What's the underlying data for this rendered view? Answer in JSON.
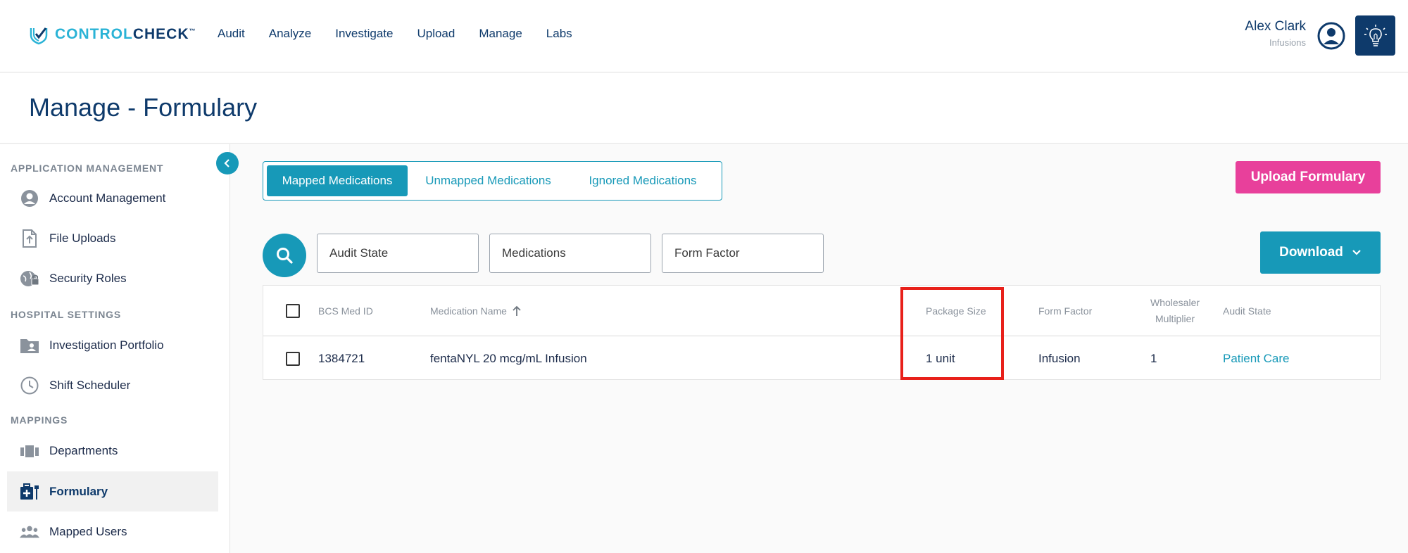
{
  "brand": {
    "name_part1": "CONTROL",
    "name_part2": "CHECK",
    "tm": "™"
  },
  "nav": {
    "items": [
      "Audit",
      "Analyze",
      "Investigate",
      "Upload",
      "Manage",
      "Labs"
    ]
  },
  "user": {
    "name": "Alex Clark",
    "org": "Infusions"
  },
  "page": {
    "title": "Manage - Formulary"
  },
  "sidebar": {
    "sections": [
      {
        "heading": "APPLICATION MANAGEMENT",
        "items": [
          "Account Management",
          "File Uploads",
          "Security Roles"
        ]
      },
      {
        "heading": "HOSPITAL SETTINGS",
        "items": [
          "Investigation Portfolio",
          "Shift Scheduler"
        ]
      },
      {
        "heading": "MAPPINGS",
        "items": [
          "Departments",
          "Formulary",
          "Mapped Users"
        ]
      }
    ],
    "active": "Formulary"
  },
  "tabs": {
    "mapped": "Mapped Medications",
    "unmapped": "Unmapped Medications",
    "ignored": "Ignored Medications"
  },
  "buttons": {
    "upload": "Upload Formulary",
    "download": "Download"
  },
  "filters": {
    "audit_state": "Audit State",
    "medications": "Medications",
    "form_factor": "Form Factor"
  },
  "table": {
    "headers": {
      "med_id": "BCS Med ID",
      "med_name": "Medication Name",
      "package_size": "Package Size",
      "form_factor": "Form Factor",
      "wholesaler_1": "Wholesaler",
      "wholesaler_2": "Multiplier",
      "audit_state": "Audit State"
    },
    "rows": [
      {
        "med_id": "1384721",
        "med_name": "fentaNYL 20 mcg/mL Infusion",
        "package_size": "1 unit",
        "form_factor": "Infusion",
        "wholesaler_multiplier": "1",
        "audit_state": "Patient Care"
      }
    ]
  },
  "colors": {
    "primary": "#1799b8",
    "navy": "#0e3a6b",
    "pink": "#e8409b",
    "highlight": "#e8201a"
  }
}
